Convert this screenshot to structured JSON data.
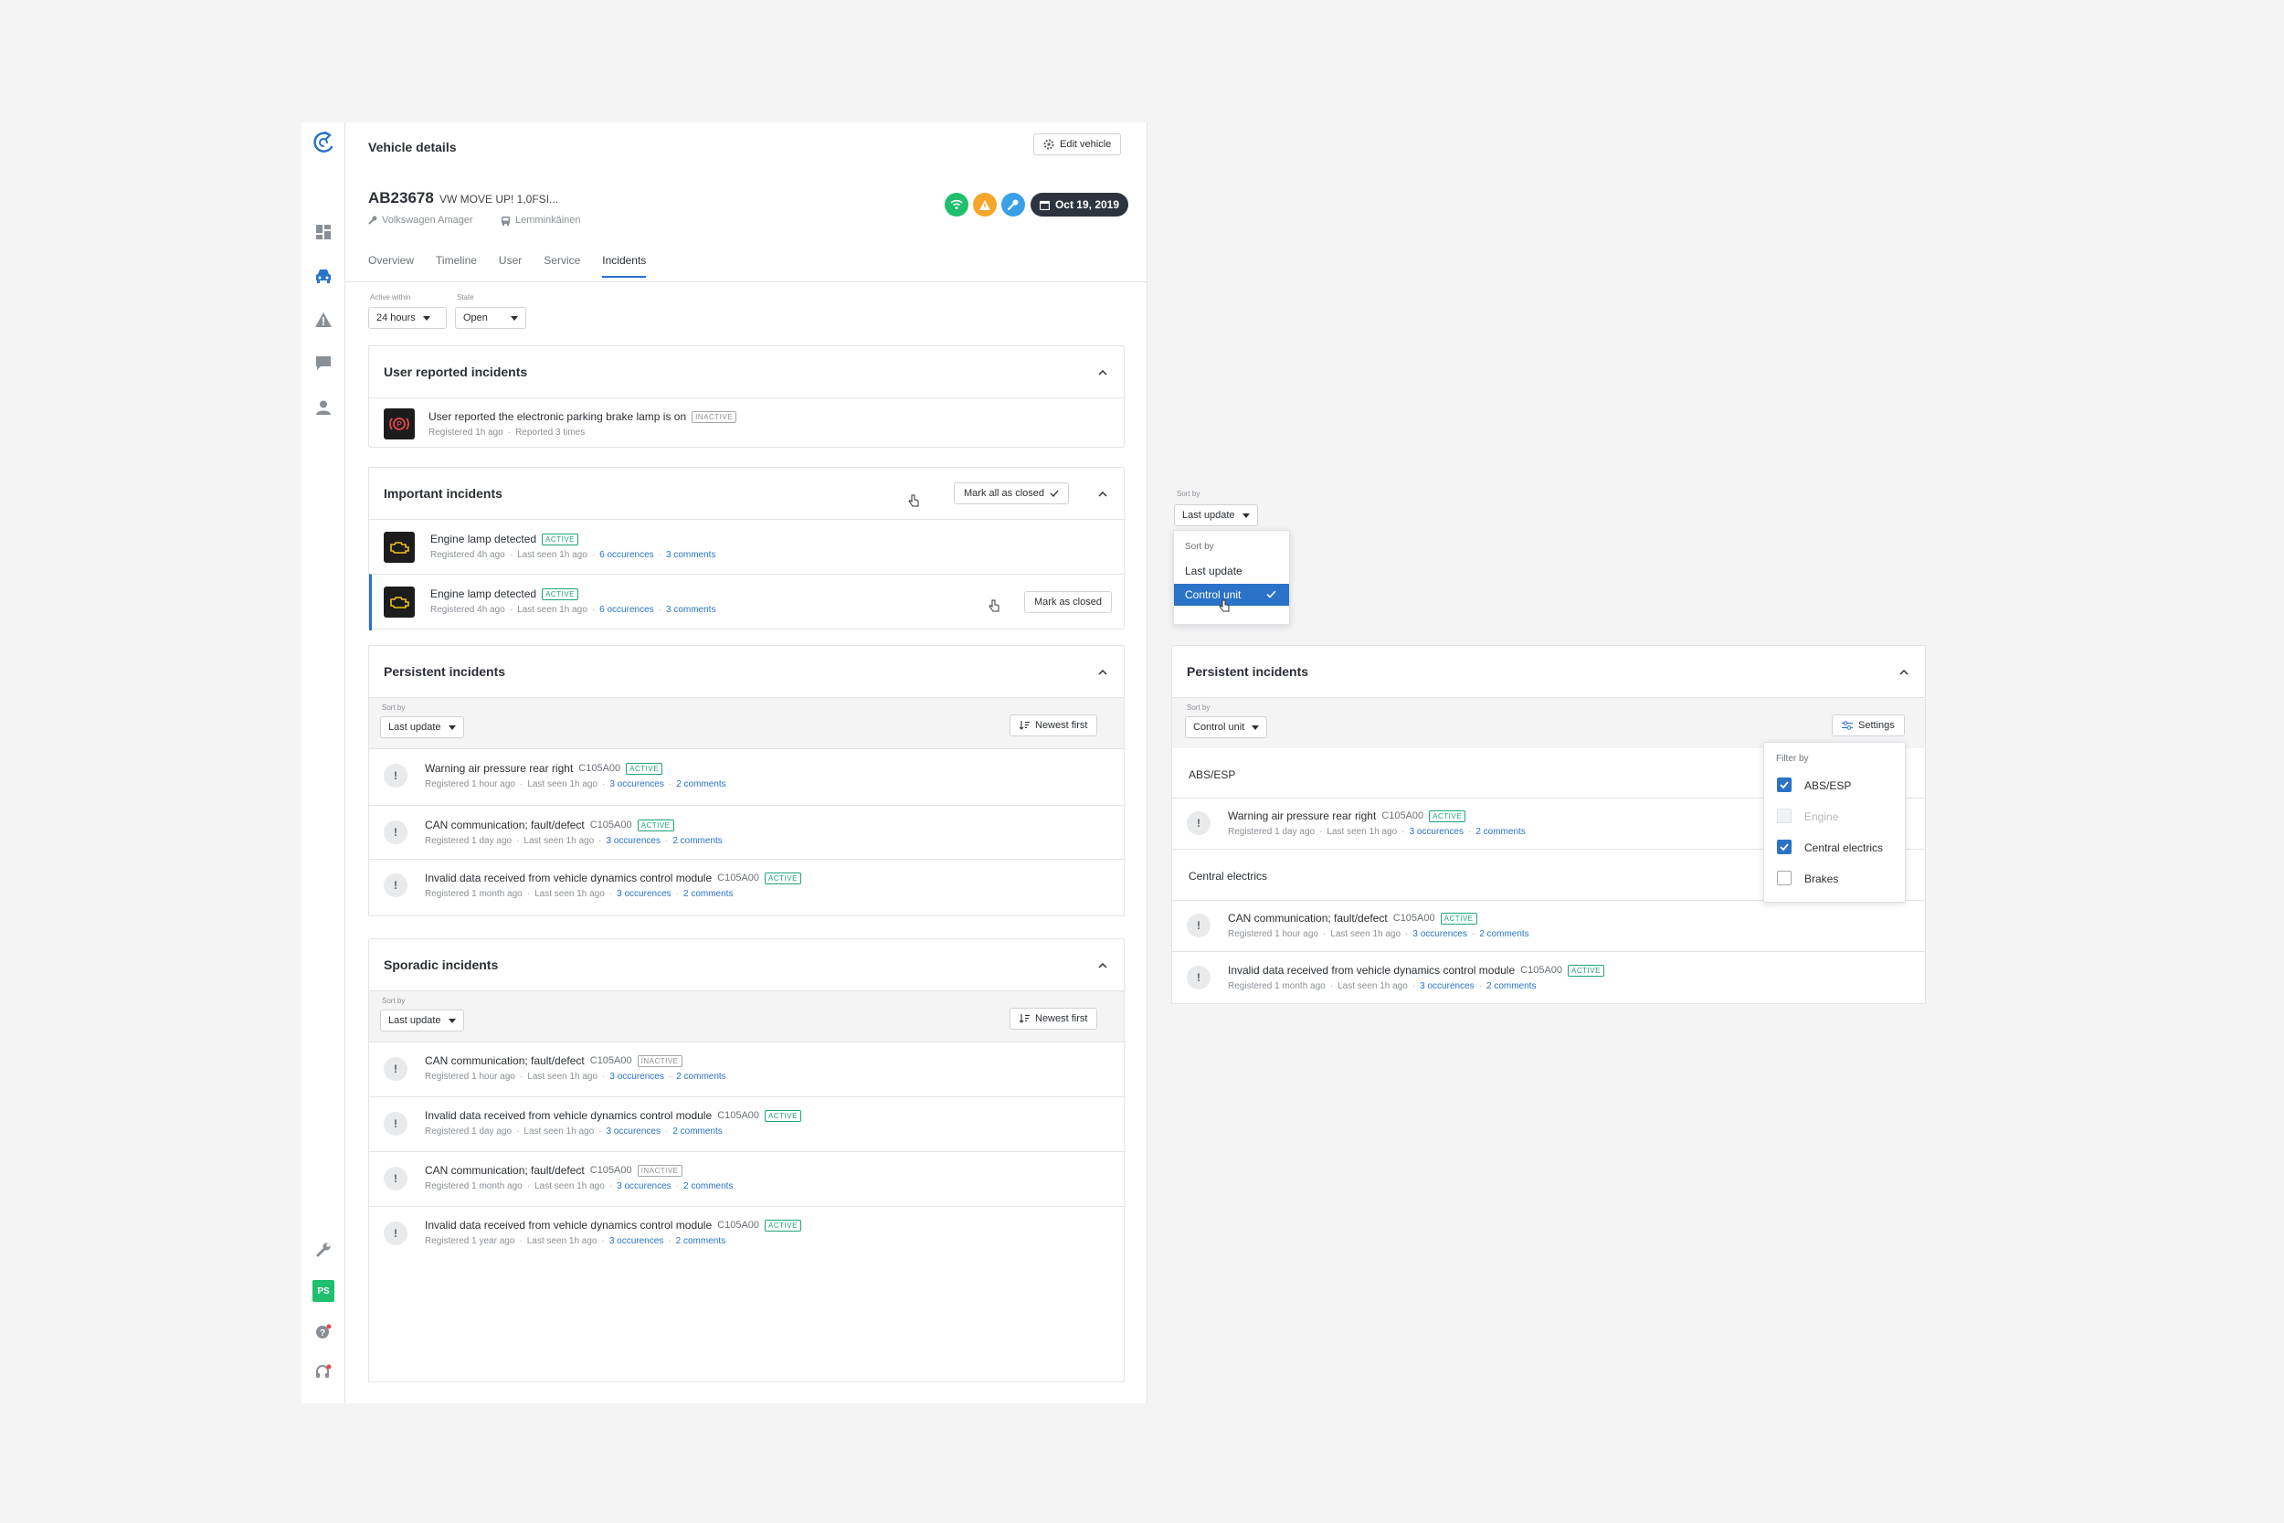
{
  "header": {
    "page_title": "Vehicle details",
    "edit_label": "Edit vehicle"
  },
  "vehicle": {
    "plate": "AB23678",
    "model": "VW MOVE UP! 1,0FSI...",
    "workshop": "Volkswagen Amager",
    "owner": "Lemminkäinen",
    "date": "Oct 19, 2019"
  },
  "status_colors": {
    "wifi": "#1fbf6e",
    "warning": "#f4a62a",
    "service": "#3aa0e8"
  },
  "tabs": [
    "Overview",
    "Timeline",
    "User",
    "Service",
    "Incidents"
  ],
  "filters": {
    "active_label": "Active within",
    "active_value": "24 hours",
    "state_label": "State",
    "state_value": "Open"
  },
  "user_reported": {
    "title": "User reported incidents",
    "item": {
      "title": "User reported the electronic parking brake lamp is on",
      "badge": "INACTIVE",
      "registered": "Registered 1h ago",
      "reported": "Reported 3 times"
    }
  },
  "important": {
    "title": "Important incidents",
    "mark_all": "Mark all as closed",
    "mark_one": "Mark as closed",
    "items": [
      {
        "title": "Engine lamp detected",
        "badge": "ACTIVE",
        "registered": "Registered 4h ago",
        "seen": "Last seen 1h ago",
        "occ": "6 occurences",
        "com": "3 comments"
      },
      {
        "title": "Engine lamp detected",
        "badge": "ACTIVE",
        "registered": "Registered 4h ago",
        "seen": "Last seen 1h ago",
        "occ": "6 occurences",
        "com": "3 comments"
      }
    ]
  },
  "persistent": {
    "title": "Persistent incidents",
    "sort_label": "Sort by",
    "sort_value": "Last update",
    "order": "Newest first",
    "items": [
      {
        "title": "Warning air pressure rear right",
        "code": "C105A00",
        "badge": "ACTIVE",
        "registered": "Registered 1 hour ago",
        "seen": "Last seen 1h ago",
        "occ": "3 occurences",
        "com": "2 comments"
      },
      {
        "title": "CAN communication; fault/defect",
        "code": "C105A00",
        "badge": "ACTIVE",
        "registered": "Registered 1 day ago",
        "seen": "Last seen 1h ago",
        "occ": "3 occurences",
        "com": "2 comments"
      },
      {
        "title": "Invalid data received from vehicle dynamics control module",
        "code": "C105A00",
        "badge": "ACTIVE",
        "registered": "Registered 1 month ago",
        "seen": "Last seen 1h ago",
        "occ": "3 occurences",
        "com": "2 comments"
      }
    ]
  },
  "sporadic": {
    "title": "Sporadic incidents",
    "sort_label": "Sort by",
    "sort_value": "Last update",
    "order": "Newest first",
    "items": [
      {
        "title": "CAN communication; fault/defect",
        "code": "C105A00",
        "badge": "INACTIVE",
        "registered": "Registered 1 hour ago",
        "seen": "Last seen 1h ago",
        "occ": "3 occurences",
        "com": "2 comments"
      },
      {
        "title": "Invalid data received from vehicle dynamics control module",
        "code": "C105A00",
        "badge": "ACTIVE",
        "registered": "Registered 1 day ago",
        "seen": "Last seen 1h ago",
        "occ": "3 occurences",
        "com": "2 comments"
      },
      {
        "title": "CAN communication; fault/defect",
        "code": "C105A00",
        "badge": "INACTIVE",
        "registered": "Registered 1 month ago",
        "seen": "Last seen 1h ago",
        "occ": "3 occurences",
        "com": "2 comments"
      },
      {
        "title": "Invalid data received from vehicle dynamics control module",
        "code": "C105A00",
        "badge": "ACTIVE",
        "registered": "Registered 1 year ago",
        "seen": "Last seen 1h ago",
        "occ": "3 occurences",
        "com": "2 comments"
      }
    ]
  },
  "sort_dropdown": {
    "label": "Sort by",
    "value": "Last update",
    "menu_head": "Sort by",
    "options": [
      "Last update",
      "Control unit"
    ],
    "selected": "Control unit"
  },
  "persistent_grouped": {
    "title": "Persistent incidents",
    "sort_label": "Sort by",
    "sort_value": "Control unit",
    "settings": "Settings",
    "group1": "ABS/ESP",
    "group2": "Central electrics",
    "items": [
      {
        "title": "Warning air pressure rear right",
        "code": "C105A00",
        "badge": "ACTIVE",
        "registered": "Registered 1 day ago",
        "seen": "Last seen 1h ago",
        "occ": "3 occurences",
        "com": "2 comments"
      },
      {
        "title": "CAN communication; fault/defect",
        "code": "C105A00",
        "badge": "ACTIVE",
        "registered": "Registered 1 hour ago",
        "seen": "Last seen 1h ago",
        "occ": "3 occurences",
        "com": "2 comments"
      },
      {
        "title": "Invalid data received from vehicle dynamics control module",
        "code": "C105A00",
        "badge": "ACTIVE",
        "registered": "Registered 1 month ago",
        "seen": "Last seen 1h ago",
        "occ": "3 occurences",
        "com": "2 comments"
      }
    ],
    "filter": {
      "head": "Filter by",
      "options": [
        "ABS/ESP",
        "Engine",
        "Central electrics",
        "Brakes"
      ],
      "checked": [
        true,
        false,
        true,
        false
      ],
      "disabled": [
        false,
        true,
        false,
        false
      ]
    }
  },
  "user_avatar": "PS"
}
